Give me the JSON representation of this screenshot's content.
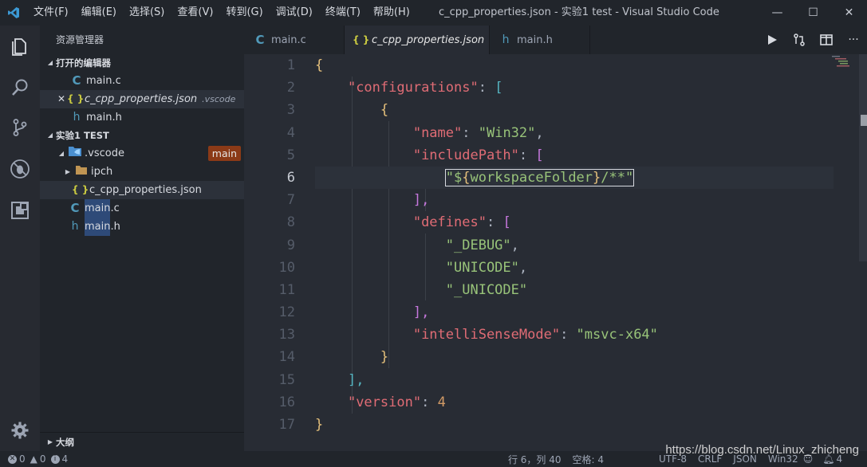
{
  "titlebar": {
    "menu": [
      "文件(F)",
      "编辑(E)",
      "选择(S)",
      "查看(V)",
      "转到(G)",
      "调试(D)",
      "终端(T)",
      "帮助(H)"
    ],
    "window_title": "c_cpp_properties.json - 实验1 test - Visual Studio Code",
    "minimize": "—",
    "maximize": "☐",
    "close": "✕"
  },
  "sidebar": {
    "header": "资源管理器",
    "open_editors": {
      "title": "打开的编辑器",
      "items": [
        {
          "icon": "C",
          "name": "main.c"
        },
        {
          "icon": "{ }",
          "name": "c_cpp_properties.json",
          "folder": ".vscode",
          "close": "✕"
        },
        {
          "icon": "h",
          "name": "main.h"
        }
      ]
    },
    "workspace": {
      "title": "实验1 TEST",
      "vscode_folder": ".vscode",
      "badge": "main",
      "ipch_folder": "ipch",
      "json_file": "c_cpp_properties.json",
      "main_c_name": "main",
      "main_c_ext": ".c",
      "main_h_name": "main",
      "main_h_ext": ".h"
    },
    "outline": "大纲"
  },
  "tabs": [
    {
      "icon": "C",
      "label": "main.c"
    },
    {
      "icon": "{ }",
      "label": "c_cpp_properties.json",
      "close": "✕"
    },
    {
      "icon": "h",
      "label": "main.h"
    }
  ],
  "editor": {
    "line_numbers": [
      "1",
      "2",
      "3",
      "4",
      "5",
      "6",
      "7",
      "8",
      "9",
      "10",
      "11",
      "12",
      "13",
      "14",
      "15",
      "16",
      "17"
    ],
    "current_line": 6,
    "code": {
      "l1": "{",
      "l2_key": "\"configurations\"",
      "l2_open": "[",
      "l3": "{",
      "l4_key": "\"name\"",
      "l4_val": "\"Win32\"",
      "l5_key": "\"includePath\"",
      "l5_open": "[",
      "l6_q": "\"$",
      "l6_ob": "{",
      "l6_var": "workspaceFolder",
      "l6_cb": "}",
      "l6_rest": "/**\"",
      "l7": "],",
      "l8_key": "\"defines\"",
      "l8_open": "[",
      "l9": "\"_DEBUG\"",
      "l10": "\"UNICODE\"",
      "l11": "\"_UNICODE\"",
      "l12": "],",
      "l13_key": "\"intelliSenseMode\"",
      "l13_val": "\"msvc-x64\"",
      "l14": "}",
      "l15": "],",
      "l16_key": "\"version\"",
      "l16_val": "4",
      "l17": "}",
      "colon": ": ",
      "comma": ","
    }
  },
  "statusbar": {
    "errors": "0",
    "warnings": "0",
    "infos": "4",
    "position": "行 6，列 40",
    "spaces": "空格: 4",
    "encoding": "UTF-8",
    "eol": "CRLF",
    "language": "JSON",
    "config": "Win32",
    "notifications": "4"
  },
  "watermark": "https://blog.csdn.net/Linux_zhicheng",
  "colors": {
    "key": "#e06c75",
    "string": "#98c379",
    "number": "#d19a66",
    "accent_badge": "#8b3a17"
  }
}
